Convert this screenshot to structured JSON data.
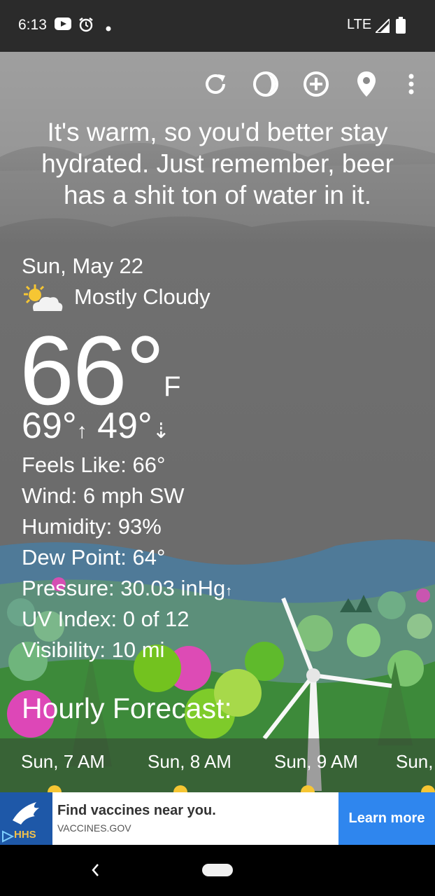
{
  "status_bar": {
    "time": "6:13",
    "network": "LTE",
    "icons": [
      "youtube-icon",
      "alarm-icon",
      "dot-icon",
      "signal-icon",
      "battery-icon"
    ]
  },
  "toolbar": {
    "icons": [
      "refresh-icon",
      "theme-icon",
      "add-location-icon",
      "location-pin-icon",
      "more-vert-icon"
    ]
  },
  "message": "It's warm, so you'd better stay hydrated. Just remember, beer has a shit ton of water in it.",
  "weather": {
    "date": "Sun, May 22",
    "condition": "Mostly Cloudy",
    "condition_icon": "partly-cloudy-icon",
    "temp": "66°",
    "unit": "F",
    "high": "69°",
    "low": "49°",
    "feels_like": "Feels Like:  66°",
    "wind": "Wind:  6 mph SW",
    "humidity": "Humidity:  93%",
    "dew_point": "Dew Point:  64°",
    "pressure": "Pressure:  30.03 inHg",
    "uv_index": "UV Index:  0 of 12",
    "visibility": "Visibility:  10 mi"
  },
  "hourly": {
    "title": "Hourly Forecast:",
    "hours": [
      "Sun, 7 AM",
      "Sun, 8 AM",
      "Sun, 9 AM",
      "Sun,"
    ]
  },
  "ad": {
    "logo_text": "HHS",
    "headline": "Find vaccines near you.",
    "url": "VACCINES.GOV",
    "cta": "Learn more"
  },
  "colors": {
    "ad_cta": "#2f86ee",
    "hhs_blue": "#1e58a8",
    "status_bar": "#2b2b2b"
  }
}
